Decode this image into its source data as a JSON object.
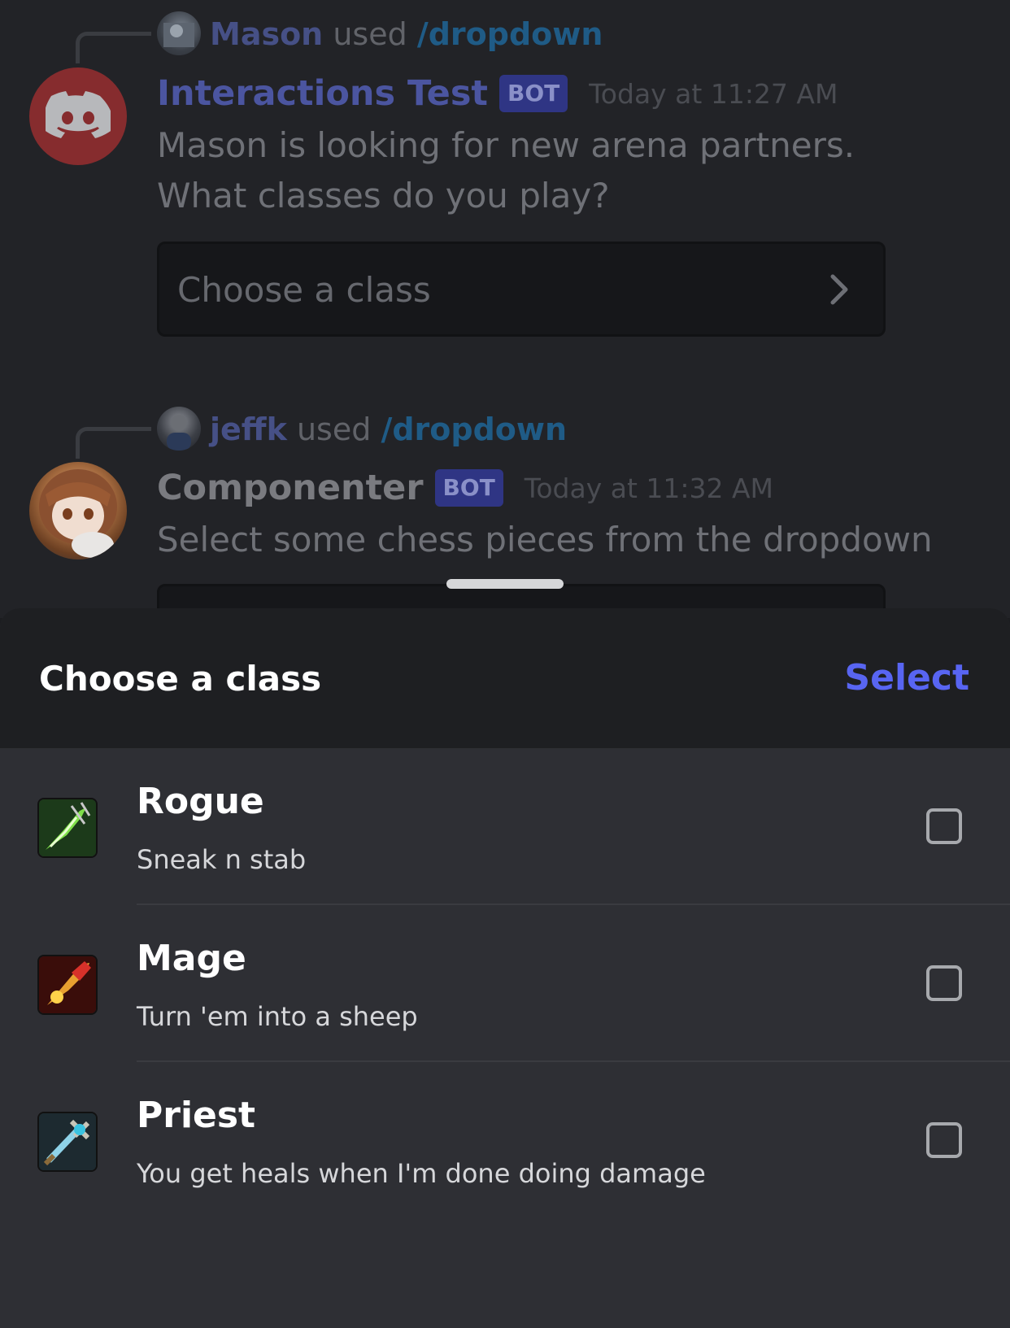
{
  "messages": [
    {
      "reply": {
        "user": "Mason",
        "used": "used",
        "command": "/dropdown"
      },
      "author": "Interactions Test",
      "bot_tag": "BOT",
      "timestamp": "Today at 11:27 AM",
      "body": "Mason is looking for new arena partners. What classes do you play?",
      "dropdown_placeholder": "Choose a class"
    },
    {
      "reply": {
        "user": "jeffk",
        "used": "used",
        "command": "/dropdown"
      },
      "author": "Componenter",
      "bot_tag": "BOT",
      "timestamp": "Today at 11:32 AM",
      "body": "Select some chess pieces from the dropdown"
    }
  ],
  "sheet": {
    "title": "Choose a class",
    "select_label": "Select",
    "options": [
      {
        "label": "Rogue",
        "description": "Sneak n stab",
        "icon": "rogue-class-icon",
        "checked": false
      },
      {
        "label": "Mage",
        "description": "Turn 'em into a sheep",
        "icon": "mage-class-icon",
        "checked": false
      },
      {
        "label": "Priest",
        "description": "You get heals when I'm done doing damage",
        "icon": "priest-class-icon",
        "checked": false
      }
    ]
  },
  "colors": {
    "accent": "#5865f2",
    "bot_tag_bg": "#2f3584",
    "command_link": "#1f5b86",
    "sheet_bg": "#2e2f34",
    "sheet_header_bg": "#1e1f22"
  }
}
